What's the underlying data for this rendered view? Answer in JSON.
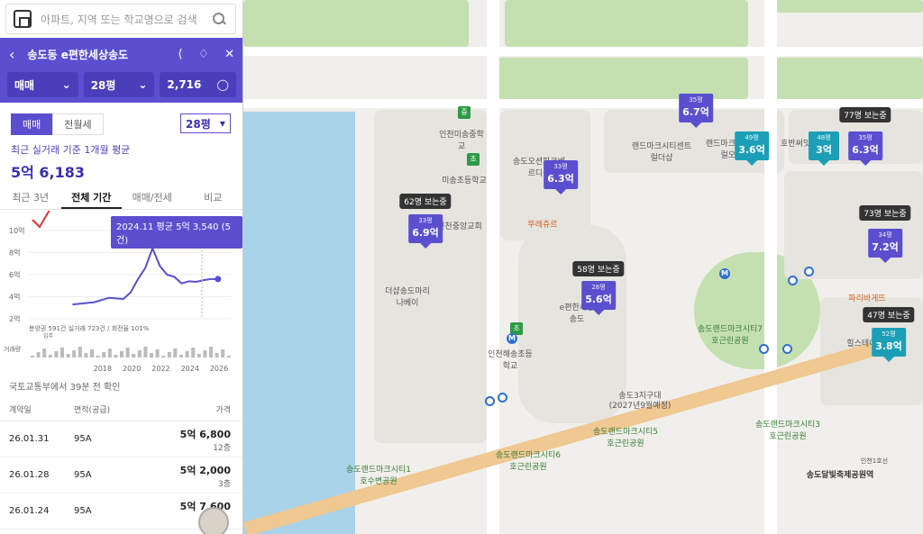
{
  "search": {
    "placeholder": "아파트, 지역 또는 학교명으로 검색"
  },
  "header": {
    "title": "송도동 e편한세상송도",
    "deal_type": "매매",
    "area": "28평",
    "count": "2,716"
  },
  "subtabs": {
    "sale": "매매",
    "rent": "전월세",
    "area_select": "28평"
  },
  "summary": {
    "caption": "최근 실거래 기준 1개월 평균",
    "value": "5억 6,183"
  },
  "period_tabs": [
    "최근 3년",
    "전체 기간",
    "매매/전세",
    "비교"
  ],
  "chart_data": {
    "type": "line",
    "tooltip": "2024.11 평균 5억 3,540 (5건)",
    "y_ticks": [
      "10억",
      "8억",
      "6억",
      "4억",
      "2억"
    ],
    "ylim": [
      2,
      10
    ],
    "x_ticks": [
      "2018",
      "2020",
      "2022",
      "2024",
      "2026"
    ],
    "xlim": [
      2013,
      2027
    ],
    "series": [
      {
        "name": "실거래",
        "x": [
          2016,
          2017.5,
          2018.5,
          2019.5,
          2020,
          2020.5,
          2021,
          2021.5,
          2022,
          2022.5,
          2023,
          2023.5,
          2024,
          2024.5,
          2025,
          2025.5,
          2026
        ],
        "values": [
          3.3,
          3.5,
          3.9,
          3.8,
          4.4,
          5.6,
          6.6,
          8.4,
          6.8,
          6.0,
          5.8,
          5.2,
          5.4,
          5.35,
          5.5,
          5.6,
          5.6
        ]
      }
    ],
    "legend": "분양권 591건  실거래 723건 / 회전율 101%",
    "volume_label": "거래량",
    "move_in_label": "입주"
  },
  "table": {
    "confirm_note": "국토교통부에서 39분 전 확인",
    "headers": [
      "계약일",
      "면적(공급)",
      "가격"
    ],
    "rows": [
      {
        "date": "26.01.31",
        "area": "95A",
        "price": "5억 6,800",
        "floor": "12층"
      },
      {
        "date": "26.01.28",
        "area": "95A",
        "price": "5억 2,000",
        "floor": "3층"
      },
      {
        "date": "26.01.24",
        "area": "95A",
        "price": "5억 7,600",
        "floor": ""
      }
    ]
  },
  "map": {
    "signs": [
      {
        "size": "35평",
        "price": "6.7억",
        "color": "purple"
      },
      {
        "size": "33평",
        "price": "6.3억",
        "color": "purple"
      },
      {
        "size": "33평",
        "price": "6.9억",
        "color": "purple"
      },
      {
        "size": "28평",
        "price": "5.6억",
        "color": "purple"
      },
      {
        "size": "49평",
        "price": "3.6억",
        "color": "teal"
      },
      {
        "size": "48평",
        "price": "3억",
        "color": "teal"
      },
      {
        "size": "35평",
        "price": "6.3억",
        "color": "purple"
      },
      {
        "size": "34평",
        "price": "7.2억",
        "color": "purple"
      },
      {
        "size": "52평",
        "price": "3.8억",
        "color": "teal"
      }
    ],
    "viewers": [
      "62명 보는중",
      "58명 보는중",
      "77명 보는중",
      "73명 보는중",
      "47명 보는중"
    ],
    "labels": [
      "인천미송중학교",
      "미송초등학교",
      "송도오션파크베르디움",
      "랜드마크시티센트럴더샵",
      "랜드마크시티센트럴오피스",
      "호반써밋오피스",
      "인천중앙교회",
      "뚜레쥬르",
      "더샵송도마리나베이",
      "e편한세상송도",
      "인천해송초등학교",
      "송도랜드마크시티7호근린공원",
      "파리바게뜨",
      "힐스테이트",
      "송도3지구대",
      "(2027년9월예정)",
      "송도랜드마크시티5호근린공원",
      "송도랜드마크시티3호근린공원",
      "송도랜드마크시티6호근린공원",
      "송도랜드마크시티1호수변공원",
      "송도달빛축제공원역",
      "인천1호선"
    ]
  }
}
